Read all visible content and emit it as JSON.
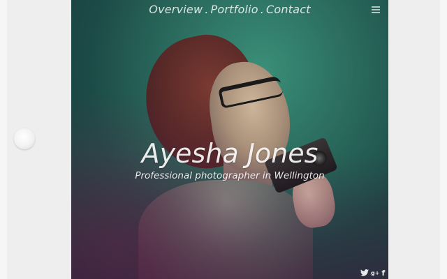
{
  "nav": {
    "items": [
      {
        "label": "Overview"
      },
      {
        "label": "Portfolio"
      },
      {
        "label": "Contact"
      }
    ],
    "separator": "."
  },
  "hero": {
    "title": "Ayesha Jones",
    "subtitle": "Professional photographer in Wellington"
  },
  "social": {
    "icons": [
      "twitter-icon",
      "google-plus-icon",
      "facebook-icon"
    ],
    "google_plus_glyph": "g+",
    "facebook_glyph": "f"
  },
  "icons": {
    "menu": "hamburger-menu-icon"
  },
  "colors": {
    "bezel": "#eeeeee",
    "photo_tint": "#2a6a5d",
    "text": "#ffffff"
  }
}
